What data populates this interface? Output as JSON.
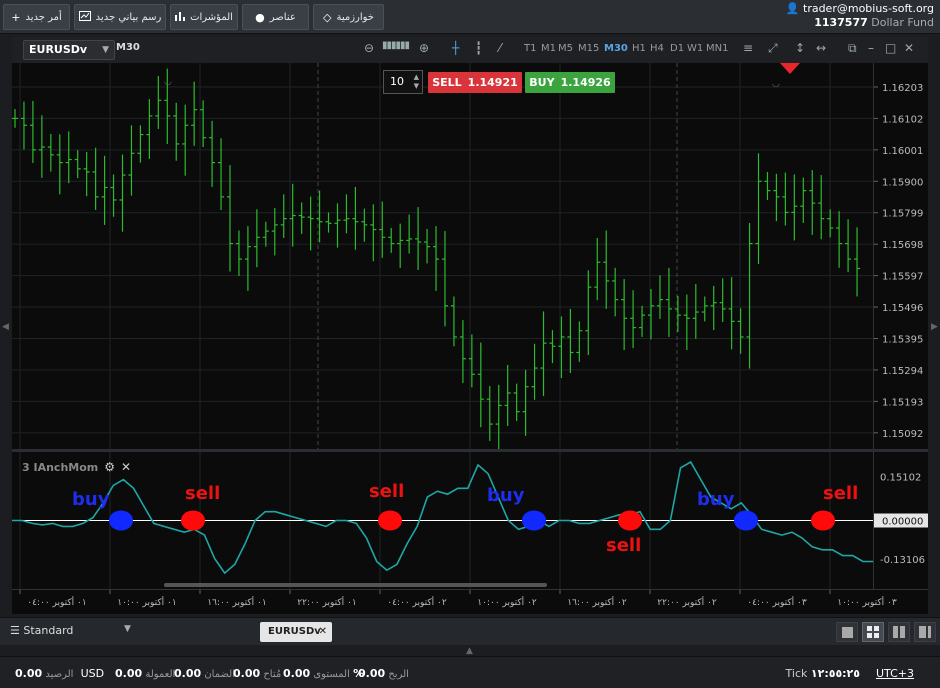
{
  "toolbar": {
    "new_order": "أمر جديد",
    "new_chart": "رسم بياني جديد",
    "indicators": "المؤشرات",
    "elements": "عناصر",
    "algorithms": "خوارزمية"
  },
  "account": {
    "email": "trader@mobius-soft.org",
    "number": "1137577",
    "fund": "Dollar Fund"
  },
  "chart": {
    "symbol": "EURUSDv",
    "timeframe": "M30",
    "timeframes": [
      "T1",
      "M1",
      "M5",
      "M15",
      "M30",
      "H1",
      "H4",
      "D1",
      "W1",
      "MN1"
    ],
    "active_timeframe": "M30",
    "quantity": "10",
    "sell_label": "SELL",
    "sell_price": "1.14921",
    "buy_label": "BUY",
    "buy_price": "1.14926",
    "price_ticks": [
      "1.16203",
      "1.16102",
      "1.16001",
      "1.15900",
      "1.15799",
      "1.15698",
      "1.15597",
      "1.15496",
      "1.15395",
      "1.15294",
      "1.15193",
      "1.15092"
    ],
    "indicator_name": "3 IAnchMom",
    "indicator_ticks": [
      "0.15102",
      "0.00000",
      "-0.13106"
    ],
    "time_labels": [
      "٠١ أكتوبر ٠٤:٠٠",
      "٠١ أكتوبر ١٠:٠٠",
      "٠١ أكتوبر ١٦:٠٠",
      "٠١ أكتوبر ٢٢:٠٠",
      "٠٢ أكتوبر ٠٤:٠٠",
      "٠٢ أكتوبر ١٠:٠٠",
      "٠٢ أكتوبر ١٦:٠٠",
      "٠٢ أكتوبر ٢٢:٠٠",
      "٠٣ أكتوبر ٠٤:٠٠",
      "٠٣ أكتوبر ١٠:٠٠"
    ],
    "colors": {
      "candle": "#2dbb2d",
      "indicator": "#1fa6a6",
      "buy_marker": "#1128ff",
      "sell_marker": "#ff0a0a"
    }
  },
  "chart_data": {
    "type": "line",
    "candle_closes": [
      1.16102,
      1.1608,
      1.16001,
      1.1601,
      1.15985,
      1.1596,
      1.1597,
      1.1594,
      1.1593,
      1.1585,
      1.1588,
      1.1584,
      1.1592,
      1.1599,
      1.1605,
      1.1611,
      1.1616,
      1.1611,
      1.1602,
      1.1608,
      1.1613,
      1.1604,
      1.1596,
      1.1585,
      1.157,
      1.1565,
      1.1569,
      1.1572,
      1.1574,
      1.1576,
      1.1578,
      1.1579,
      1.15785,
      1.1578,
      1.1577,
      1.15765,
      1.15775,
      1.1578,
      1.1577,
      1.1576,
      1.15745,
      1.1572,
      1.157,
      1.1571,
      1.15715,
      1.15705,
      1.1569,
      1.1565,
      1.155,
      1.154,
      1.1533,
      1.1528,
      1.152,
      1.1512,
      1.1518,
      1.1522,
      1.1516,
      1.1524,
      1.153,
      1.1538,
      1.1537,
      1.154,
      1.1535,
      1.1542,
      1.1556,
      1.1564,
      1.1558,
      1.1552,
      1.1546,
      1.1543,
      1.1547,
      1.155,
      1.1552,
      1.1549,
      1.1547,
      1.1546,
      1.1548,
      1.155,
      1.1551,
      1.1549,
      1.1545,
      1.154,
      1.157,
      1.159,
      1.1587,
      1.1585,
      1.158,
      1.1582,
      1.1587,
      1.1583,
      1.1578,
      1.1575,
      1.157,
      1.1565,
      1.1562
    ],
    "indicator_values": [
      0.0,
      0.0,
      -0.01,
      -0.015,
      -0.01,
      -0.02,
      -0.02,
      -0.01,
      0.01,
      0.06,
      0.12,
      0.14,
      0.11,
      0.05,
      -0.01,
      -0.02,
      -0.03,
      -0.04,
      -0.03,
      -0.05,
      -0.13,
      -0.18,
      -0.15,
      -0.08,
      0.0,
      0.03,
      0.03,
      0.02,
      0.01,
      0.0,
      -0.01,
      -0.02,
      0.0,
      0.0,
      -0.01,
      -0.06,
      -0.14,
      -0.17,
      -0.15,
      -0.08,
      -0.02,
      0.08,
      0.1,
      0.09,
      0.11,
      0.11,
      0.19,
      0.16,
      0.08,
      0.0,
      -0.03,
      -0.02,
      0.0,
      -0.02,
      0.0,
      0.0,
      -0.01,
      -0.01,
      0.0,
      0.01,
      0.02,
      0.02,
      0.03,
      -0.03,
      -0.03,
      0.0,
      0.18,
      0.2,
      0.14,
      0.08,
      0.06,
      0.04,
      0.06,
      0.02,
      -0.03,
      -0.04,
      -0.05,
      -0.04,
      -0.06,
      -0.09,
      -0.1,
      -0.1,
      -0.12,
      -0.12,
      -0.14,
      -0.14
    ],
    "signals": [
      {
        "label": "buy",
        "type": "buy"
      },
      {
        "label": "sell",
        "type": "sell"
      },
      {
        "label": "sell",
        "type": "sell"
      },
      {
        "label": "buy",
        "type": "buy"
      },
      {
        "label": "sell",
        "type": "sell"
      },
      {
        "label": "buy",
        "type": "buy"
      },
      {
        "label": "sell",
        "type": "sell"
      }
    ],
    "price_range": [
      1.1504,
      1.1628
    ],
    "indicator_range": [
      -0.2,
      0.2
    ]
  },
  "tabs": {
    "workspace": "Standard",
    "open_tab": "EURUSDv"
  },
  "status": {
    "balance_label": "الرصيد",
    "balance": "0.00",
    "currency": "USD",
    "commission_label": "العمولة",
    "commission": "0.00",
    "margin_label": "الضمان",
    "margin": "0.00",
    "free_margin_label": "مُتاح",
    "free_margin": "0.00",
    "level_label": "المستوى",
    "level": "0.00",
    "level_unit": "%",
    "profit_label": "الربح",
    "profit": "0.00",
    "tick_label": "Tick",
    "time": "١٢:٥٥:٢٥",
    "timezone": "UTC+3"
  }
}
